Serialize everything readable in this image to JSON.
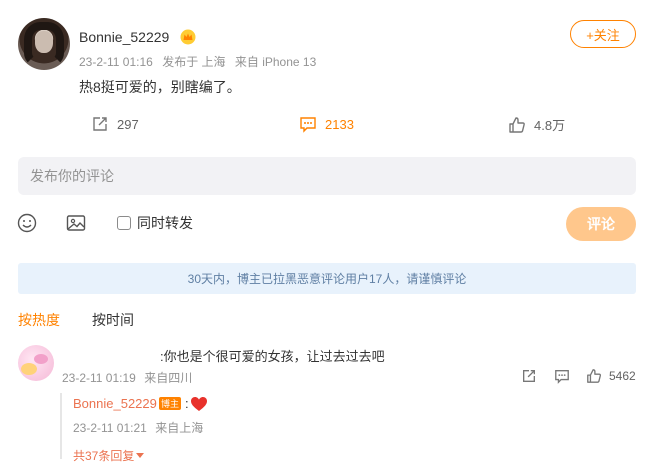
{
  "post": {
    "username": "Bonnie_52229",
    "date": "23-2-11 01:16",
    "location": "发布于 上海",
    "source": "来自 iPhone 13",
    "text": "热8挺可爱的，别瞎编了。",
    "follow_label": "+关注",
    "reposts": "297",
    "comments": "2133",
    "likes": "4.8万"
  },
  "compose": {
    "placeholder": "发布你的评论",
    "repost_checkbox_label": "同时转发",
    "submit_label": "评论"
  },
  "notice": "30天内，博主已拉黑恶意评论用户17人，请谨慎评论",
  "sort": {
    "hot_label": "按热度",
    "time_label": "按时间"
  },
  "comment": {
    "text": ":你也是个很可爱的女孩，让过去过去吧",
    "date": "23-2-11 01:19",
    "location": "来自四川",
    "likes": "5462"
  },
  "reply": {
    "username": "Bonnie_52229",
    "badge": "博主",
    "colon": ":",
    "date": "23-2-11 01:21",
    "location": "来自上海",
    "more_label": "共37条回复"
  },
  "colors": {
    "accent": "#ff8200",
    "reply_name": "#eb7350",
    "notice_bg": "#e8f2fc",
    "heart": "#e8312b"
  }
}
